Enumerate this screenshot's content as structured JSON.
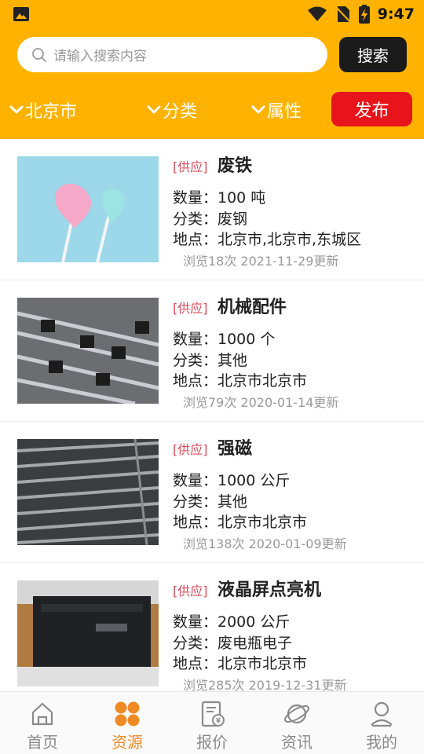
{
  "status_bar": {
    "time": "9:47"
  },
  "search": {
    "placeholder": "请输入搜索内容",
    "button_label": "搜索"
  },
  "filters": {
    "city": "北京市",
    "category": "分类",
    "attribute": "属性",
    "publish_label": "发布"
  },
  "listings": [
    {
      "tag": "[供应]",
      "title": "废铁",
      "quantity": "数量：100 吨",
      "category": "分类：废钢",
      "location": "地点：北京市,北京市,东城区",
      "meta": "浏览18次 2021-11-29更新"
    },
    {
      "tag": "[供应]",
      "title": "机械配件",
      "quantity": "数量：1000 个",
      "category": "分类：其他",
      "location": "地点：北京市北京市",
      "meta": "浏览79次 2020-01-14更新"
    },
    {
      "tag": "[供应]",
      "title": "强磁",
      "quantity": "数量：1000 公斤",
      "category": "分类：其他",
      "location": "地点：北京市北京市",
      "meta": "浏览138次 2020-01-09更新"
    },
    {
      "tag": "[供应]",
      "title": "液晶屏点亮机",
      "quantity": "数量：2000 公斤",
      "category": "分类：废电瓶电子",
      "location": "地点：北京市北京市",
      "meta": "浏览285次 2019-12-31更新"
    }
  ],
  "bottom_nav": [
    {
      "label": "首页",
      "icon": "home-icon"
    },
    {
      "label": "资源",
      "icon": "resources-icon",
      "active": true
    },
    {
      "label": "报价",
      "icon": "quote-icon"
    },
    {
      "label": "资讯",
      "icon": "news-icon"
    },
    {
      "label": "我的",
      "icon": "profile-icon"
    }
  ],
  "colors": {
    "header": "#ffb300",
    "publish": "#e8141b",
    "nav_active": "#f08a24",
    "tag": "#e04a5a"
  }
}
